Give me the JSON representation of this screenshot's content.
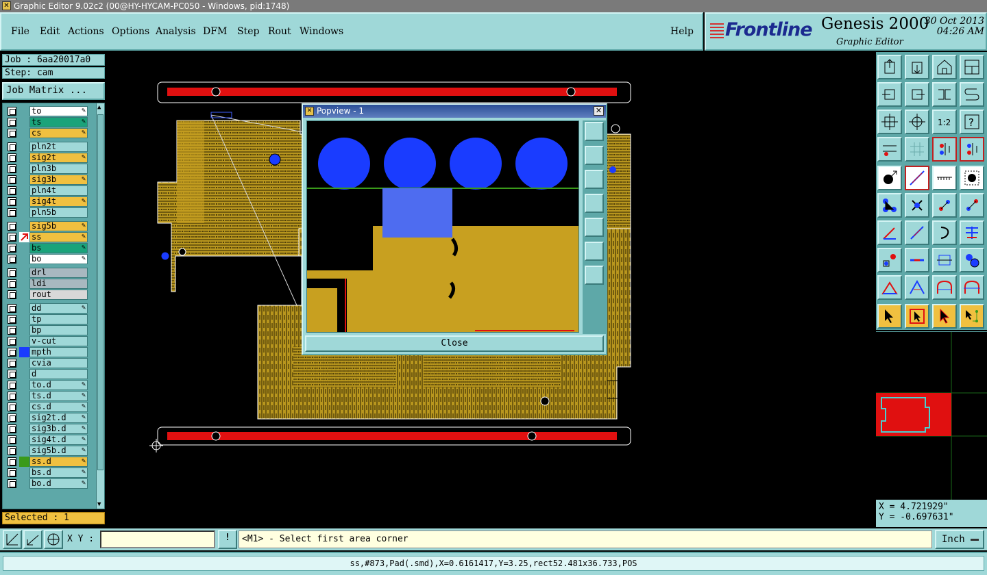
{
  "window": {
    "title": "Graphic Editor 9.02c2 (00@HY-HYCAM-PC050 - Windows, pid:1748)"
  },
  "menu": {
    "items": [
      "File",
      "Edit",
      "Actions",
      "Options",
      "Analysis",
      "DFM",
      "Step",
      "Rout",
      "Windows"
    ],
    "help": "Help"
  },
  "brand": {
    "logo": "Frontline",
    "product": "Genesis 2000",
    "subtitle": "Graphic Editor",
    "date": "30 Oct 2013",
    "time": "04:26 AM"
  },
  "job": {
    "job_label": "Job : 6aa20017a0",
    "step_label": "Step: cam",
    "matrix_button": "Job Matrix ..."
  },
  "layers": [
    {
      "name": "to",
      "color": "#ffffff",
      "pen": true
    },
    {
      "name": "ts",
      "color": "#1aa37a",
      "pen": true
    },
    {
      "name": "cs",
      "color": "#f0c040",
      "pen": true
    },
    {
      "name": "pln2t",
      "color": "#9fd8d8",
      "pen": false
    },
    {
      "name": "sig2t",
      "color": "#f0c040",
      "pen": true
    },
    {
      "name": "pln3b",
      "color": "#9fd8d8",
      "pen": false
    },
    {
      "name": "sig3b",
      "color": "#f0c040",
      "pen": true
    },
    {
      "name": "pln4t",
      "color": "#9fd8d8",
      "pen": false
    },
    {
      "name": "sig4t",
      "color": "#f0c040",
      "pen": true
    },
    {
      "name": "pln5b",
      "color": "#9fd8d8",
      "pen": false
    },
    {
      "name": "sig5b",
      "color": "#f0c040",
      "pen": true
    },
    {
      "name": "ss",
      "color": "#f0c040",
      "pen": true,
      "active": true
    },
    {
      "name": "bs",
      "color": "#1aa37a",
      "pen": true
    },
    {
      "name": "bo",
      "color": "#ffffff",
      "pen": true
    },
    {
      "name": "drl",
      "color": "#a8b8c0",
      "pen": false
    },
    {
      "name": "ldi",
      "color": "#a8b8c0",
      "pen": false
    },
    {
      "name": "rout",
      "color": "#d8d8d8",
      "pen": false
    },
    {
      "name": "dd",
      "color": "#9fd8d8",
      "pen": true
    },
    {
      "name": "tp",
      "color": "#9fd8d8",
      "pen": false
    },
    {
      "name": "bp",
      "color": "#9fd8d8",
      "pen": false
    },
    {
      "name": "v-cut",
      "color": "#9fd8d8",
      "pen": false
    },
    {
      "name": "mpth",
      "color": "#9fd8d8",
      "pen": false,
      "swatch": "#1a3cff"
    },
    {
      "name": "cvia",
      "color": "#9fd8d8",
      "pen": false
    },
    {
      "name": "d",
      "color": "#9fd8d8",
      "pen": false
    },
    {
      "name": "to.d",
      "color": "#9fd8d8",
      "pen": true
    },
    {
      "name": "ts.d",
      "color": "#9fd8d8",
      "pen": true
    },
    {
      "name": "cs.d",
      "color": "#9fd8d8",
      "pen": true
    },
    {
      "name": "sig2t.d",
      "color": "#9fd8d8",
      "pen": true
    },
    {
      "name": "sig3b.d",
      "color": "#9fd8d8",
      "pen": true
    },
    {
      "name": "sig4t.d",
      "color": "#9fd8d8",
      "pen": true
    },
    {
      "name": "sig5b.d",
      "color": "#9fd8d8",
      "pen": true
    },
    {
      "name": "ss.d",
      "color": "#f0c040",
      "pen": true,
      "swatch": "#3a9a1a"
    },
    {
      "name": "bs.d",
      "color": "#9fd8d8",
      "pen": true
    },
    {
      "name": "bo.d",
      "color": "#9fd8d8",
      "pen": true
    }
  ],
  "selected_label": "Selected : 1",
  "popview": {
    "title": "Popview - 1",
    "close_label": "Close"
  },
  "coords": {
    "x": "X = 4.721929\"",
    "y": "Y = -0.697631\""
  },
  "bottom": {
    "xy_label": "X Y :",
    "xy_value": "",
    "prompt": "<M1> - Select first area corner",
    "unit": "Inch"
  },
  "status": "ss,#873,Pad(.smd),X=0.6161417,Y=3.25,rect52.481x36.733,POS",
  "colors": {
    "panel": "#9fd8d8",
    "panel_dark": "#5ea8a8",
    "board": "#c8a020",
    "copper": "#b8961e",
    "rail": "#e01010",
    "pad_blue": "#1a3cff",
    "highlight": "#f0c040"
  }
}
